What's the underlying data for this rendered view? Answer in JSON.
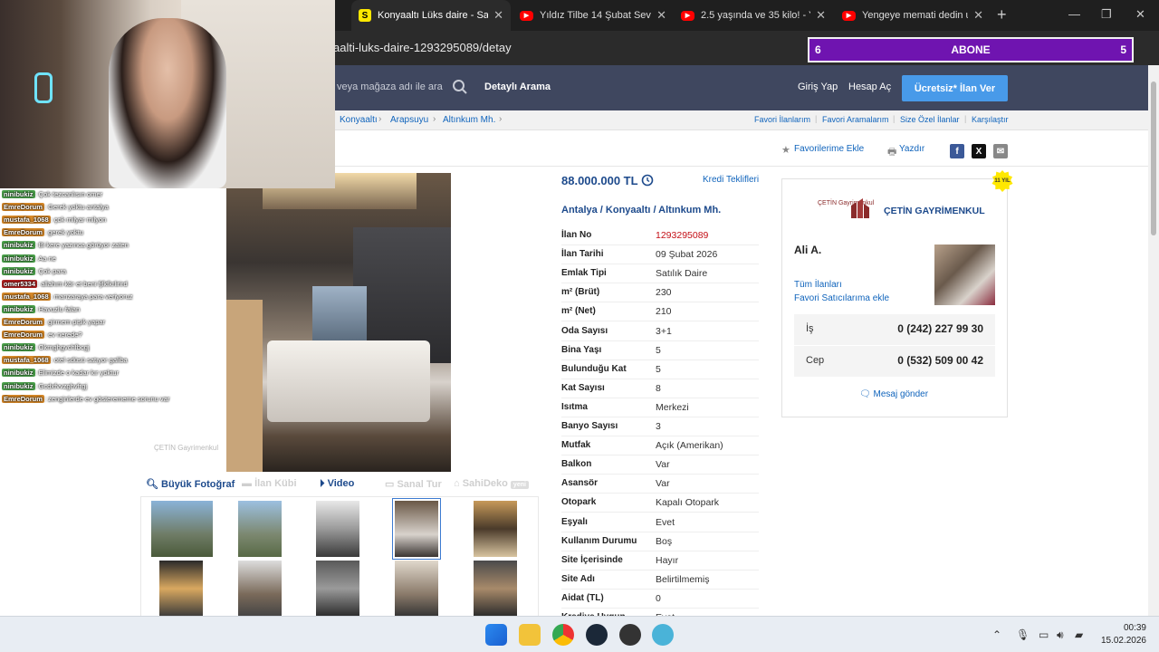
{
  "browser": {
    "tabs": [
      {
        "title": "Konyaaltı Lüks daire - Satılı",
        "icon": "sahibinden-favicon",
        "active": true
      },
      {
        "title": "Yıldız Tilbe 14 Şubat Sevgil",
        "icon": "youtube-favicon"
      },
      {
        "title": "2.5 yaşında ve 35 kilo! - Yo",
        "icon": "youtube-favicon"
      },
      {
        "title": "Yengeye memati dedin ust",
        "icon": "youtube-favicon"
      }
    ],
    "url": "aalti-luks-daire-1293295089/detay"
  },
  "overlay": {
    "abone_left": "6",
    "abone_label": "ABONE",
    "abone_right": "5"
  },
  "site": {
    "search_placeholder": "veya mağaza adı ile ara",
    "detayli_arama": "Detaylı Arama",
    "giris_yap": "Giriş Yap",
    "hesap_ac": "Hesap Aç",
    "ucretsiz_ilan": "Ücretsiz* İlan Ver"
  },
  "breadcrumb": [
    "Konyaaltı",
    "Arapsuyu",
    "Altınkum Mh."
  ],
  "top_links": [
    "Favori İlanlarım",
    "Favori Aramalarım",
    "Size Özel İlanlar",
    "Karşılaştır"
  ],
  "actions": {
    "favorilerime_ekle": "Favorilerime Ekle",
    "yazdir": "Yazdır",
    "share": [
      "f",
      "X",
      "✉"
    ]
  },
  "photo_tabs": [
    {
      "label": "Büyük Fotoğraf",
      "active": true
    },
    {
      "label": "İlan Kübi",
      "active": false
    },
    {
      "label": "Video",
      "active": true
    },
    {
      "label": "Sanal Tur",
      "active": false
    },
    {
      "label": "SahiDeko",
      "active": false,
      "tag": "yeni"
    }
  ],
  "watermark": "ÇETİN Gayrimenkul",
  "listing": {
    "price": "88.000.000 TL",
    "kredi": "Kredi Teklifleri",
    "location": "Antalya  /  Konyaaltı  /  Altınkum Mh.",
    "details": [
      {
        "key": "İlan No",
        "value": "1293295089",
        "highlight": true
      },
      {
        "key": "İlan Tarihi",
        "value": "09 Şubat 2026"
      },
      {
        "key": "Emlak Tipi",
        "value": "Satılık Daire"
      },
      {
        "key": "m² (Brüt)",
        "value": "230"
      },
      {
        "key": "m² (Net)",
        "value": "210"
      },
      {
        "key": "Oda Sayısı",
        "value": "3+1"
      },
      {
        "key": "Bina Yaşı",
        "value": "5"
      },
      {
        "key": "Bulunduğu Kat",
        "value": "5"
      },
      {
        "key": "Kat Sayısı",
        "value": "8"
      },
      {
        "key": "Isıtma",
        "value": "Merkezi"
      },
      {
        "key": "Banyo Sayısı",
        "value": "3"
      },
      {
        "key": "Mutfak",
        "value": "Açık (Amerikan)"
      },
      {
        "key": "Balkon",
        "value": "Var"
      },
      {
        "key": "Asansör",
        "value": "Var"
      },
      {
        "key": "Otopark",
        "value": "Kapalı Otopark"
      },
      {
        "key": "Eşyalı",
        "value": "Evet"
      },
      {
        "key": "Kullanım Durumu",
        "value": "Boş"
      },
      {
        "key": "Site İçerisinde",
        "value": "Hayır"
      },
      {
        "key": "Site Adı",
        "value": "Belirtilmemiş"
      },
      {
        "key": "Aidat (TL)",
        "value": "0"
      },
      {
        "key": "Krediye Uygun",
        "value": "Evet"
      }
    ]
  },
  "seller": {
    "badge": "11 YIL",
    "logo_text": "ÇETİN Gayrimenkul",
    "name": "ÇETİN GAYRİMENKUL",
    "agent": "Ali A.",
    "tum_ilanlari": "Tüm İlanları",
    "favori_satici": "Favori Satıcılarıma ekle",
    "phones": [
      {
        "label": "İş",
        "number": "0 (242) 227 99 30"
      },
      {
        "label": "Cep",
        "number": "0 (532) 509 00 42"
      }
    ],
    "mesaj": "Mesaj gönder"
  },
  "chat": [
    {
      "user": "ninibukiz",
      "color": "green",
      "text": ": Çok tezcanlısın omer"
    },
    {
      "user": "EmreDorum",
      "color": "orange",
      "text": ": Gerek yoktu antalya"
    },
    {
      "user": "mustafa_1068",
      "color": "orange",
      "text": ": çok milyar milyon"
    },
    {
      "user": "EmreDorum",
      "color": "orange",
      "text": ": gerek yoktu"
    },
    {
      "user": "ninibukiz",
      "color": "green",
      "text": ": Bi kere yazınca görüyor zaten"
    },
    {
      "user": "ninibukiz",
      "color": "green",
      "text": ": Aa ne"
    },
    {
      "user": "ninibukiz",
      "color": "green",
      "text": ": Çok para"
    },
    {
      "user": "omer5334",
      "color": "red",
      "text": ": allahım kör et beni fjfkfkrlirird"
    },
    {
      "user": "mustafa_1068",
      "color": "orange",
      "text": ": manzaraya para veriyoruz"
    },
    {
      "user": "ninibukiz",
      "color": "green",
      "text": ": Havuzlu falan"
    },
    {
      "user": "EmreDorum",
      "color": "orange",
      "text": ": girmem pişik yapar"
    },
    {
      "user": "EmreDorum",
      "color": "orange",
      "text": ": ev nerede?"
    },
    {
      "user": "ninibukiz",
      "color": "green",
      "text": ": Okmghgvchfbcgj"
    },
    {
      "user": "mustafa_1068",
      "color": "orange",
      "text": ": otel sdüsü satıyor galiba"
    },
    {
      "user": "ninibukiz",
      "color": "green",
      "text": ": Elimizde o kadar kır yoktur"
    },
    {
      "user": "ninibukiz",
      "color": "green",
      "text": ": Gcdxfvvzghvfrgj"
    },
    {
      "user": "EmreDorum",
      "color": "orange",
      "text": ": zenginlerde ev gösterememe sorunu var"
    }
  ],
  "taskbar": {
    "time": "00:39",
    "date": "15.02.2026"
  },
  "colors": {
    "header_bg": "#3f475f",
    "accent_blue": "#1d4a8c",
    "cta": "#489ae9",
    "abone_bg": "#6f14b0",
    "ilan_no": "#c40f16"
  }
}
